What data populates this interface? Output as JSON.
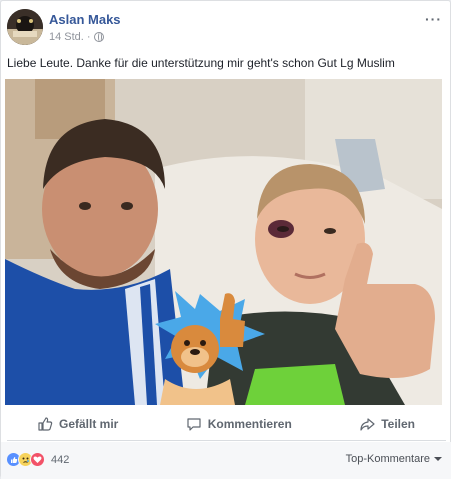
{
  "post": {
    "author": "Aslan Maks",
    "time": "14 Std.",
    "separator": "·",
    "more": "···",
    "text": "Liebe Leute. Danke für die unterstützung mir geht's schon Gut Lg Muslim"
  },
  "actions": {
    "like": "Gefällt mir",
    "comment": "Kommentieren",
    "share": "Teilen"
  },
  "footer": {
    "reaction_types": [
      "like",
      "sad",
      "love"
    ],
    "reaction_count": "442",
    "sort_label": "Top-Kommentare"
  },
  "colors": {
    "link": "#365899",
    "muted": "#90949c",
    "action": "#606770",
    "like_blue": "#5890ff"
  },
  "icons": {
    "like": "thumbs-up-icon",
    "comment": "speech-bubble-icon",
    "share": "share-arrow-icon",
    "privacy": "globe-icon"
  }
}
